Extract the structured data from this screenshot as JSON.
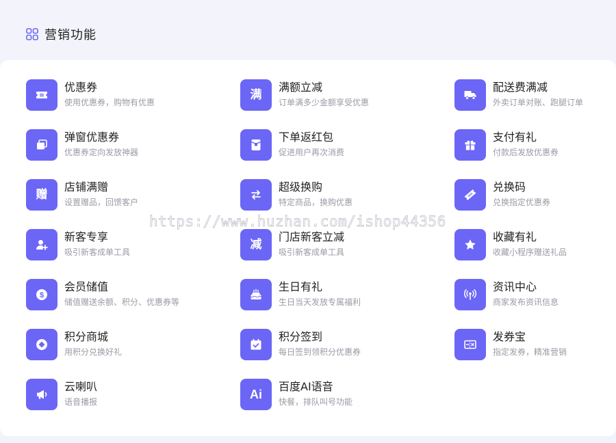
{
  "section": {
    "title": "营销功能",
    "icon": "grid-icon"
  },
  "colors": {
    "accent": "#6b66f5",
    "background": "#f3f3fb",
    "card": "#ffffff",
    "title_text": "#222222",
    "desc_text": "#9a9aa6"
  },
  "items": [
    {
      "title": "优惠券",
      "desc": "使用优惠券，购物有优惠",
      "icon": "ticket-icon"
    },
    {
      "title": "满额立减",
      "desc": "订单满多少金额享受优惠",
      "icon": "full-reduction-icon",
      "glyph": "满"
    },
    {
      "title": "配送费满减",
      "desc": "外卖订单对账、跑腿订单",
      "icon": "delivery-truck-icon"
    },
    {
      "title": "弹窗优惠券",
      "desc": "优惠券定向发放神器",
      "icon": "popup-window-icon"
    },
    {
      "title": "下单返红包",
      "desc": "促进用户再次消费",
      "icon": "red-packet-icon"
    },
    {
      "title": "支付有礼",
      "desc": "付款后发放优惠券",
      "icon": "gift-box-icon"
    },
    {
      "title": "店铺满赠",
      "desc": "设置赠品，回馈客户",
      "icon": "gift-glyph-icon",
      "glyph": "赠"
    },
    {
      "title": "超级换购",
      "desc": "特定商品，换购优惠",
      "icon": "exchange-arrows-icon"
    },
    {
      "title": "兑换码",
      "desc": "兑换指定优惠券",
      "icon": "redeem-code-icon"
    },
    {
      "title": "新客专享",
      "desc": "吸引新客成单工具",
      "icon": "add-user-icon"
    },
    {
      "title": "门店新客立减",
      "desc": "吸引新客成单工具",
      "icon": "store-reduction-icon",
      "glyph": "减"
    },
    {
      "title": "收藏有礼",
      "desc": "收藏小程序赠送礼品",
      "icon": "star-icon"
    },
    {
      "title": "会员储值",
      "desc": "储值赠送余额、积分、优惠券等",
      "icon": "dollar-coin-icon"
    },
    {
      "title": "生日有礼",
      "desc": "生日当天发放专属福利",
      "icon": "birthday-cake-icon"
    },
    {
      "title": "资讯中心",
      "desc": "商家发布资讯信息",
      "icon": "broadcast-icon"
    },
    {
      "title": "积分商城",
      "desc": "用积分兑换好礼",
      "icon": "points-mall-icon"
    },
    {
      "title": "积分签到",
      "desc": "每日签到领积分优惠券",
      "icon": "calendar-check-icon"
    },
    {
      "title": "发券宝",
      "desc": "指定发券，精准营销",
      "icon": "coupon-voucher-icon"
    },
    {
      "title": "云喇叭",
      "desc": "语音播报",
      "icon": "megaphone-icon"
    },
    {
      "title": "百度AI语音",
      "desc": "快餐，排队叫号功能",
      "icon": "ai-voice-icon",
      "glyph": "Ai"
    }
  ],
  "watermark": "https://www.huzhan.com/ishop44356"
}
